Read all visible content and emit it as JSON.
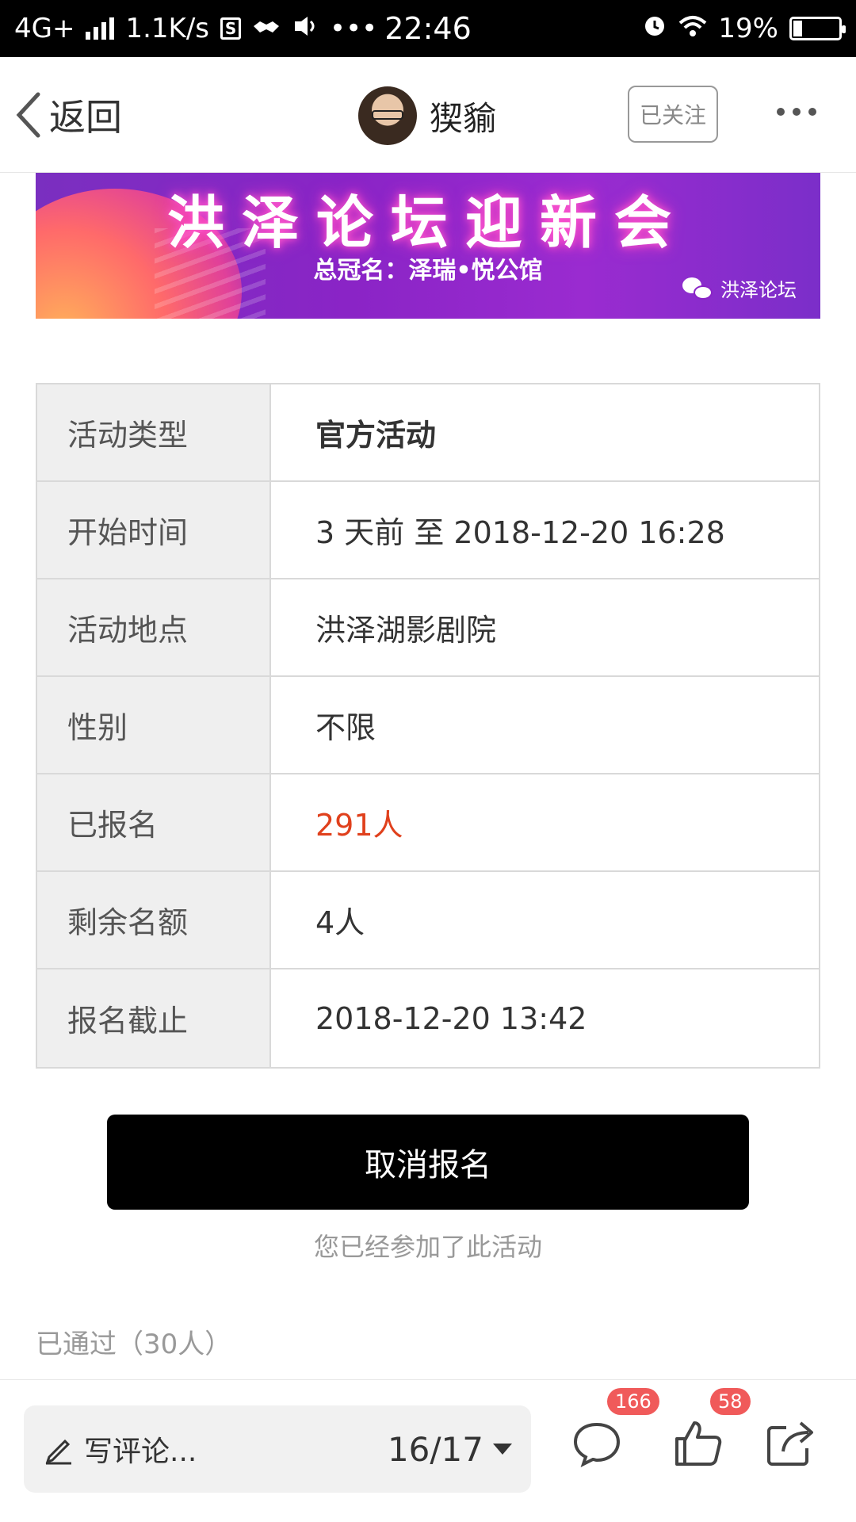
{
  "status_bar": {
    "network": "4G+",
    "speed": "1.1K/s",
    "app_box_glyph": "S",
    "time": "22:46",
    "battery": "19%",
    "battery_level": 0.19,
    "icons": [
      "signal-icon",
      "handshake-icon",
      "vibrate-icon",
      "more-dots-icon",
      "alarm-icon",
      "wifi-icon",
      "battery-icon"
    ]
  },
  "nav": {
    "back_label": "返回",
    "author_name": "猰貐",
    "follow_label": "已关注"
  },
  "banner": {
    "title": "洪泽论坛迎新会",
    "subtitle": "总冠名：泽瑞•悦公馆",
    "logo_text": "洪泽论坛"
  },
  "info": {
    "rows": [
      {
        "label": "活动类型",
        "value": "官方活动"
      },
      {
        "label": "开始时间",
        "value": "3 天前 至 2018-12-20 16:28"
      },
      {
        "label": "活动地点",
        "value": "洪泽湖影剧院"
      },
      {
        "label": "性别",
        "value": "不限"
      },
      {
        "label": "已报名",
        "value": "291人"
      },
      {
        "label": "剩余名额",
        "value": "4人"
      },
      {
        "label": "报名截止",
        "value": "2018-12-20 13:42"
      }
    ]
  },
  "action": {
    "cancel_label": "取消报名",
    "joined_note": "您已经参加了此活动",
    "passed_label": "已通过（30人）"
  },
  "bottom": {
    "comment_placeholder": "写评论...",
    "page_indicator": "16/17",
    "comment_count": "166",
    "like_count": "58"
  },
  "colors": {
    "highlight_red": "#e0401c",
    "badge_red": "#f05a5a"
  }
}
